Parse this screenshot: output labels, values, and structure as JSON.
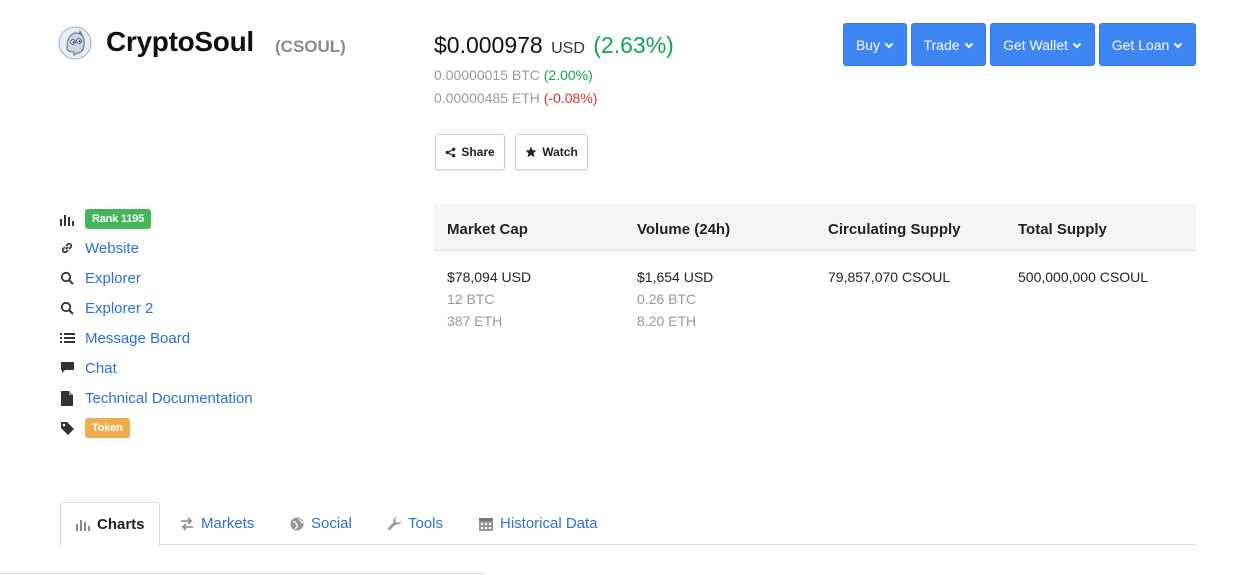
{
  "coin": {
    "name": "CryptoSoul",
    "symbol": "(CSOUL)",
    "logo_icon": "ghost-logo-icon"
  },
  "price": {
    "usd_value": "$0.000978",
    "usd_unit": "USD",
    "usd_change": "(2.63%)",
    "btc_value": "0.00000015 BTC",
    "btc_change": "(2.00%)",
    "eth_value": "0.00000485 ETH",
    "eth_change": "(-0.08%)"
  },
  "actions": {
    "share_label": "Share",
    "watch_label": "Watch"
  },
  "top_buttons": {
    "buy": "Buy",
    "trade": "Trade",
    "get_wallet": "Get Wallet",
    "get_loan": "Get Loan"
  },
  "links": {
    "rank": "Rank 1195",
    "website": "Website",
    "explorer": "Explorer",
    "explorer2": "Explorer 2",
    "message_board": "Message Board",
    "chat": "Chat",
    "technical_docs": "Technical Documentation",
    "token": "Token"
  },
  "stats": {
    "headers": [
      "Market Cap",
      "Volume (24h)",
      "Circulating Supply",
      "Total Supply"
    ],
    "market_cap": [
      "$78,094 USD",
      "12 BTC",
      "387 ETH"
    ],
    "volume": [
      "$1,654 USD",
      "0.26 BTC",
      "8.20 ETH"
    ],
    "circulating_supply": "79,857,070 CSOUL",
    "total_supply": "500,000,000 CSOUL"
  },
  "tabs": [
    "Charts",
    "Markets",
    "Social",
    "Tools",
    "Historical Data"
  ],
  "colors": {
    "primary_button": "#3f86f5",
    "link": "#2f6fcf",
    "positive": "#16a05a",
    "negative": "#d13232",
    "rank_badge": "#45b55a",
    "token_badge": "#f0ad4e"
  }
}
